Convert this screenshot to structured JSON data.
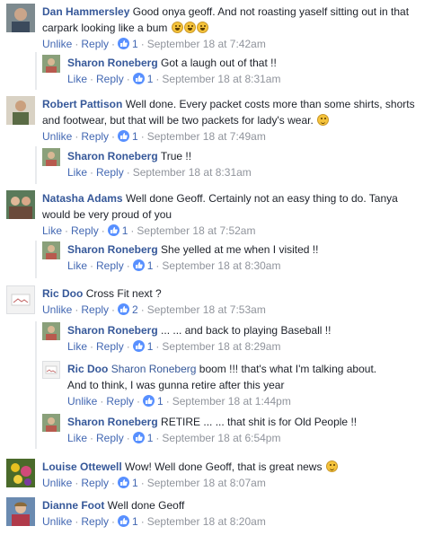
{
  "actions": {
    "unlike": "Unlike",
    "like": "Like",
    "reply": "Reply"
  },
  "comments": [
    {
      "name": "Dan Hammersley",
      "text": "Good onya geoff. And not roasting yaself sitting out in that",
      "text2": "carpark looking like a bum",
      "likes": "1",
      "time": "September 18 at 7:42am"
    },
    {
      "name": "Sharon Roneberg",
      "text": "Got a laugh out of that !!",
      "likes": "1",
      "time": "September 18 at 8:31am"
    },
    {
      "name": "Robert Pattison",
      "text": "Well done. Every packet costs more than some shirts, shorts",
      "text2": "and footwear, but that will be two packets for lady's wear.",
      "likes": "1",
      "time": "September 18 at 7:49am"
    },
    {
      "name": "Sharon Roneberg",
      "text": "True !!",
      "time": "September 18 at 8:31am"
    },
    {
      "name": "Natasha Adams",
      "text": "Well done Geoff. Certainly not an easy thing to do. Tanya",
      "text2": "would be very proud of you",
      "likes": "1",
      "time": "September 18 at 7:52am"
    },
    {
      "name": "Sharon Roneberg",
      "text": "She yelled at me when I visited !!",
      "likes": "1",
      "time": "September 18 at 8:30am"
    },
    {
      "name": "Ric Doo",
      "text": "Cross Fit next ?",
      "likes": "2",
      "time": "September 18 at 7:53am"
    },
    {
      "name": "Sharon Roneberg",
      "text": "... ... and back to playing Baseball !!",
      "likes": "1",
      "time": "September 18 at 8:29am"
    },
    {
      "name": "Ric Doo",
      "tag": "Sharon Roneberg",
      "text": "boom !!! that's what I'm talking about.",
      "text2": "And to think, I was gunna retire after this year",
      "likes": "1",
      "time": "September 18 at 1:44pm"
    },
    {
      "name": "Sharon Roneberg",
      "text": "RETIRE ... ... that shit is for Old People !!",
      "likes": "1",
      "time": "September 18 at 6:54pm"
    },
    {
      "name": "Louise Ottewell",
      "text": "Wow! Well done Geoff, that is great news",
      "likes": "1",
      "time": "September 18 at 8:07am"
    },
    {
      "name": "Dianne Foot",
      "text": "Well done Geoff",
      "likes": "1",
      "time": "September 18 at 8:20am"
    }
  ]
}
